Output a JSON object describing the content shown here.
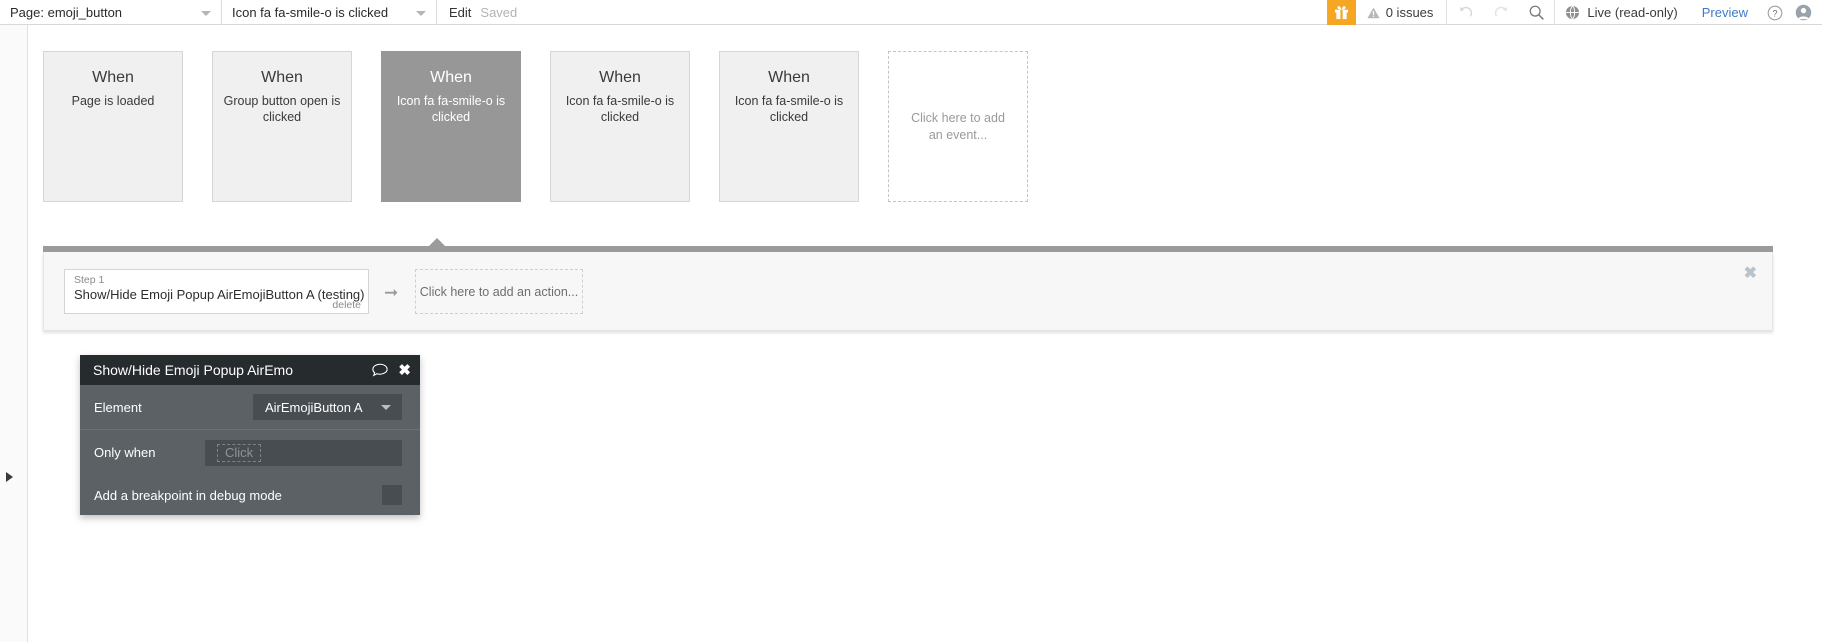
{
  "topbar": {
    "page_selector": {
      "label": "Page: emoji_button",
      "caret_icon": "chevron-down-icon"
    },
    "event_selector": {
      "label": "Icon fa fa-smile-o is clicked",
      "caret_icon": "chevron-down-icon"
    },
    "edit_label": "Edit",
    "save_status": "Saved",
    "gift_icon": "gift-icon",
    "issues": {
      "icon": "warning-triangle-icon",
      "label": "0 issues"
    },
    "undo_icon": "undo-icon",
    "redo_icon": "redo-icon",
    "search_icon": "search-icon",
    "live": {
      "icon": "globe-icon",
      "label": "Live (read-only)"
    },
    "preview_label": "Preview",
    "help_icon": "help-question-icon",
    "avatar_icon": "user-avatar-icon"
  },
  "workflow": {
    "event_cards": [
      {
        "when": "When",
        "description": "Page is loaded",
        "selected": false
      },
      {
        "when": "When",
        "description": "Group button open is clicked",
        "selected": false
      },
      {
        "when": "When",
        "description": "Icon fa fa-smile-o is clicked",
        "selected": true
      },
      {
        "when": "When",
        "description": "Icon fa fa-smile-o is clicked",
        "selected": false
      },
      {
        "when": "When",
        "description": "Icon fa fa-smile-o is clicked",
        "selected": false
      }
    ],
    "add_event_label": "Click here to add an event...",
    "steps": [
      {
        "number": "Step 1",
        "title": "Show/Hide Emoji Popup AirEmojiButton A (testing)",
        "delete_label": "delete"
      }
    ],
    "arrow_icon": "arrow-right-icon",
    "add_action_label": "Click here to add an action...",
    "close_icon": "close-icon",
    "rail_expand_icon": "triangle-right-icon"
  },
  "property_editor": {
    "title": "Show/Hide Emoji Popup AirEmo",
    "comment_icon": "speech-bubble-icon",
    "close_icon": "close-icon",
    "rows": [
      {
        "label": "Element",
        "value": "AirEmojiButton A",
        "type": "dropdown",
        "caret_icon": "chevron-down-icon"
      },
      {
        "label": "Only when",
        "placeholder": "Click",
        "type": "text"
      }
    ],
    "breakpoint_label": "Add a breakpoint in debug mode"
  },
  "colors": {
    "accent_orange": "#f5a623",
    "selected_card": "#979797",
    "panel_dark": "#5b6165",
    "panel_header": "#262b2e",
    "link_blue": "#3d7bc8"
  }
}
